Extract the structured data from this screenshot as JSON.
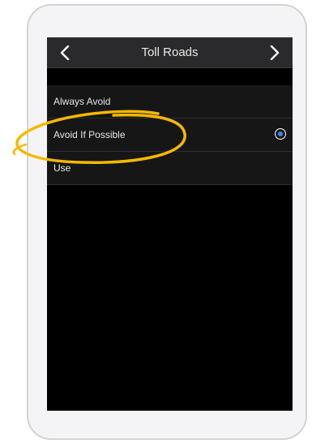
{
  "header": {
    "title": "Toll Roads",
    "back_icon": "chevron-left-icon",
    "forward_icon": "chevron-right-icon"
  },
  "options": [
    {
      "label": "Always Avoid",
      "selected": false
    },
    {
      "label": "Avoid If Possible",
      "selected": true
    },
    {
      "label": "Use",
      "selected": false
    }
  ],
  "colors": {
    "accent": "#2a8cff",
    "highlight": "#f5b800",
    "screen_bg": "#000000",
    "header_bg": "#2a2a2c"
  }
}
